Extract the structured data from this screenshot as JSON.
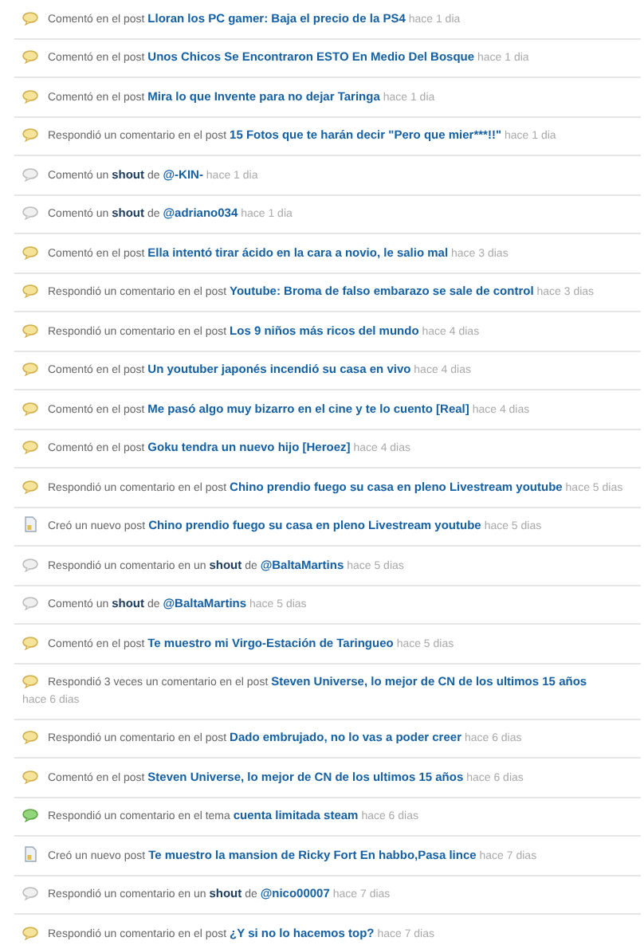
{
  "activity": [
    {
      "kind": "comment",
      "parts": [
        {
          "kind": "plain",
          "text": "Comentó en el post"
        },
        {
          "kind": "link",
          "text": "Lloran los PC gamer: Baja el precio de la PS4"
        }
      ],
      "time": "hace 1 dia"
    },
    {
      "kind": "comment",
      "parts": [
        {
          "kind": "plain",
          "text": "Comentó en el post"
        },
        {
          "kind": "link",
          "text": "Unos Chicos Se Encontraron ESTO En Medio Del Bosque"
        }
      ],
      "time": "hace 1 dia"
    },
    {
      "kind": "comment",
      "parts": [
        {
          "kind": "plain",
          "text": "Comentó en el post"
        },
        {
          "kind": "link",
          "text": "Mira lo que Invente para no dejar Taringa"
        }
      ],
      "time": "hace 1 dia"
    },
    {
      "kind": "comment",
      "parts": [
        {
          "kind": "plain",
          "text": "Respondió un comentario en el post"
        },
        {
          "kind": "link",
          "text": "15 Fotos que te harán decir \"Pero que mier***!!\""
        }
      ],
      "time": "hace 1 dia"
    },
    {
      "kind": "shout",
      "parts": [
        {
          "kind": "plain",
          "text": "Comentó un"
        },
        {
          "kind": "strong",
          "text": "shout"
        },
        {
          "kind": "plain",
          "text": "de"
        },
        {
          "kind": "link",
          "text": "@-KIN-"
        }
      ],
      "time": "hace 1 dia"
    },
    {
      "kind": "shout",
      "parts": [
        {
          "kind": "plain",
          "text": "Comentó un"
        },
        {
          "kind": "strong",
          "text": "shout"
        },
        {
          "kind": "plain",
          "text": "de"
        },
        {
          "kind": "link",
          "text": "@adriano034"
        }
      ],
      "time": "hace 1 dia"
    },
    {
      "kind": "comment",
      "parts": [
        {
          "kind": "plain",
          "text": "Comentó en el post"
        },
        {
          "kind": "link",
          "text": "Ella intentó tirar ácido en la cara a novio, le salio mal"
        }
      ],
      "time": "hace 3 dias"
    },
    {
      "kind": "comment",
      "parts": [
        {
          "kind": "plain",
          "text": "Respondió un comentario en el post"
        },
        {
          "kind": "link",
          "text": "Youtube: Broma de falso embarazo se sale de control"
        }
      ],
      "time": "hace 3 dias"
    },
    {
      "kind": "comment",
      "parts": [
        {
          "kind": "plain",
          "text": "Respondió un comentario en el post"
        },
        {
          "kind": "link",
          "text": "Los 9 niños más ricos del mundo"
        }
      ],
      "time": "hace 4 dias"
    },
    {
      "kind": "comment",
      "parts": [
        {
          "kind": "plain",
          "text": "Comentó en el post"
        },
        {
          "kind": "link",
          "text": "Un youtuber japonés incendió su casa en vivo"
        }
      ],
      "time": "hace 4 dias"
    },
    {
      "kind": "comment",
      "parts": [
        {
          "kind": "plain",
          "text": "Comentó en el post"
        },
        {
          "kind": "link",
          "text": "Me pasó algo muy bizarro en el cine y te lo cuento [Real]"
        }
      ],
      "time": "hace 4 dias"
    },
    {
      "kind": "comment",
      "parts": [
        {
          "kind": "plain",
          "text": "Comentó en el post"
        },
        {
          "kind": "link",
          "text": "Goku tendra un nuevo hijo [Heroez]"
        }
      ],
      "time": "hace 4 dias"
    },
    {
      "kind": "comment",
      "parts": [
        {
          "kind": "plain",
          "text": "Respondió un comentario en el post"
        },
        {
          "kind": "link",
          "text": "Chino prendio fuego su casa en pleno Livestream youtube"
        }
      ],
      "time": "hace 5 dias"
    },
    {
      "kind": "post",
      "parts": [
        {
          "kind": "plain",
          "text": "Creó un nuevo post"
        },
        {
          "kind": "link",
          "text": "Chino prendio fuego su casa en pleno Livestream youtube"
        }
      ],
      "time": "hace 5 dias"
    },
    {
      "kind": "shout",
      "parts": [
        {
          "kind": "plain",
          "text": "Respondió un comentario en un"
        },
        {
          "kind": "strong",
          "text": "shout"
        },
        {
          "kind": "plain",
          "text": "de"
        },
        {
          "kind": "link",
          "text": "@BaltaMartins"
        }
      ],
      "time": "hace 5 dias"
    },
    {
      "kind": "shout",
      "parts": [
        {
          "kind": "plain",
          "text": "Comentó un"
        },
        {
          "kind": "strong",
          "text": "shout"
        },
        {
          "kind": "plain",
          "text": "de"
        },
        {
          "kind": "link",
          "text": "@BaltaMartins"
        }
      ],
      "time": "hace 5 dias"
    },
    {
      "kind": "comment",
      "parts": [
        {
          "kind": "plain",
          "text": "Comentó en el post"
        },
        {
          "kind": "link",
          "text": "Te muestro mi Virgo-Estación de Taringueo"
        }
      ],
      "time": "hace 5 dias"
    },
    {
      "kind": "comment",
      "parts": [
        {
          "kind": "plain",
          "text": "Respondió 3 veces un comentario en el post"
        },
        {
          "kind": "link",
          "text": "Steven Universe, lo mejor de CN de los ultimos 15 años"
        }
      ],
      "time": "hace 6 dias"
    },
    {
      "kind": "comment",
      "parts": [
        {
          "kind": "plain",
          "text": "Respondió un comentario en el post"
        },
        {
          "kind": "link",
          "text": "Dado embrujado, no lo vas a poder creer"
        }
      ],
      "time": "hace 6 dias"
    },
    {
      "kind": "comment",
      "parts": [
        {
          "kind": "plain",
          "text": "Comentó en el post"
        },
        {
          "kind": "link",
          "text": "Steven Universe, lo mejor de CN de los ultimos 15 años"
        }
      ],
      "time": "hace 6 dias"
    },
    {
      "kind": "topic",
      "parts": [
        {
          "kind": "plain",
          "text": "Respondió un comentario en el tema"
        },
        {
          "kind": "link",
          "text": "cuenta limitada steam"
        }
      ],
      "time": "hace 6 dias"
    },
    {
      "kind": "post",
      "parts": [
        {
          "kind": "plain",
          "text": "Creó un nuevo post"
        },
        {
          "kind": "link",
          "text": "Te muestro la mansion de Ricky Fort En habbo,Pasa lince"
        }
      ],
      "time": "hace 7 dias"
    },
    {
      "kind": "shout",
      "parts": [
        {
          "kind": "plain",
          "text": "Respondió un comentario en un"
        },
        {
          "kind": "strong",
          "text": "shout"
        },
        {
          "kind": "plain",
          "text": "de"
        },
        {
          "kind": "link",
          "text": "@nico00007"
        }
      ],
      "time": "hace 7 dias"
    },
    {
      "kind": "comment",
      "parts": [
        {
          "kind": "plain",
          "text": "Respondió un comentario en el post"
        },
        {
          "kind": "link",
          "text": "¿Y si no lo hacemos top?"
        }
      ],
      "time": "hace 7 dias"
    }
  ]
}
